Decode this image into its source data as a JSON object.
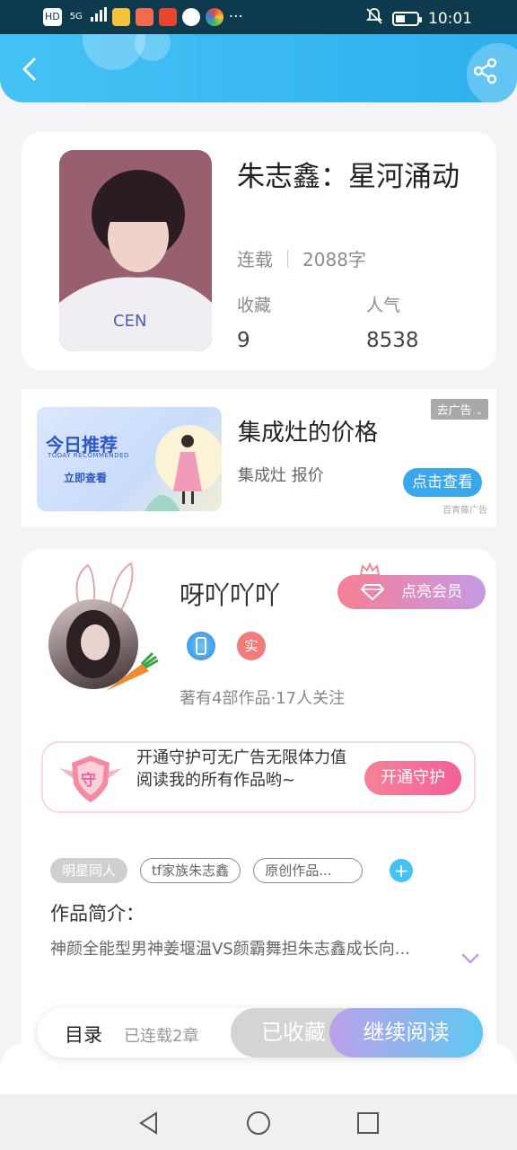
{
  "status_bar": {
    "network": "HD",
    "signal": "5G",
    "time": "10:01",
    "more": "···"
  },
  "header": {
    "back_icon": "chevron-left-icon",
    "share_icon": "share-icon",
    "color": "#3ab8f2"
  },
  "book": {
    "title": "朱志鑫：星河涌动",
    "status": "连载",
    "word_count": "2088字",
    "favorites_label": "收藏",
    "favorites_value": "9",
    "popularity_label": "人气",
    "popularity_value": "8538"
  },
  "ad": {
    "image_title": "今日推荐",
    "image_subtitle": "TODAY RECOMMENDED",
    "image_cta": "立即查看",
    "title": "集成灶的价格",
    "subtitle": "集成灶 报价",
    "close_label": "去广告",
    "cta_label": "点击查看",
    "source": "百青藤广告"
  },
  "author": {
    "name": "呀吖吖吖",
    "vip_button": "点亮会员",
    "badge_real": "实",
    "info": "著有4部作品·17人关注",
    "guard_icon_text": "守",
    "guard_text": "开通守护可无广告无限体力值阅读我的所有作品哟~",
    "guard_button": "开通守护"
  },
  "tags": [
    "明星同人",
    "tf家族朱志鑫",
    "原创作品..."
  ],
  "intro": {
    "label": "作品简介：",
    "text": "神颜全能型男神姜堰温VS颜霸舞担朱志鑫成长向..."
  },
  "actions": {
    "toc_label": "目录",
    "toc_count": "已连载2章",
    "collected_label": "已收藏",
    "read_label": "继续阅读"
  },
  "colors": {
    "accent": "#45c2f5",
    "vip_pink": "#f77f95",
    "guard_pink": "#f2609b"
  }
}
